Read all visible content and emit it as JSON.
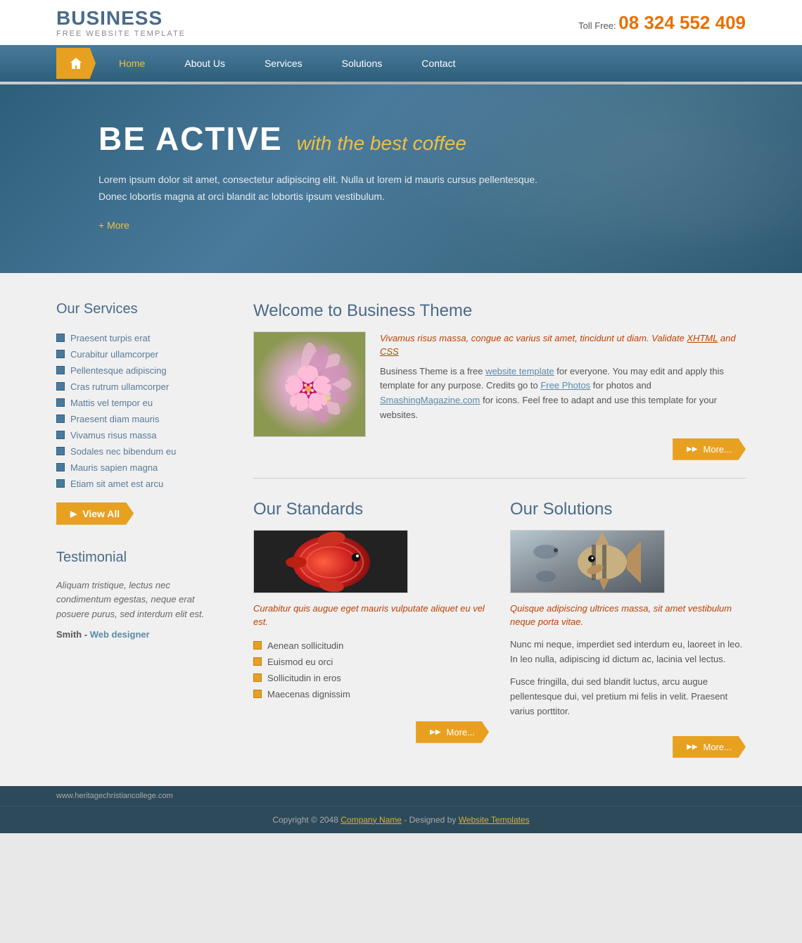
{
  "header": {
    "logo_title": "BUSINESS",
    "logo_sub": "FREE WEBSITE TEMPLATE",
    "toll_free_label": "Toll Free:",
    "phone": "08 324 552 409"
  },
  "nav": {
    "home_label": "Home",
    "items": [
      {
        "label": "About Us"
      },
      {
        "label": "Services"
      },
      {
        "label": "Solutions"
      },
      {
        "label": "Contact"
      }
    ]
  },
  "hero": {
    "title_main": "BE ACTIVE",
    "title_sub": "with the best coffee",
    "description": "Lorem ipsum dolor sit amet, consectetur adipiscing elit. Nulla ut lorem id mauris cursus pellentesque. Donec lobortis magna at orci blandit ac lobortis ipsum vestibulum.",
    "more_label": "+ More"
  },
  "sidebar": {
    "services_title": "Our Services",
    "services": [
      "Praesent turpis erat",
      "Curabitur ullamcorper",
      "Pellentesque adipiscing",
      "Cras rutrum ullamcorper",
      "Mattis vel tempor eu",
      "Praesent diam mauris",
      "Vivamus risus massa",
      "Sodales nec bibendum eu",
      "Mauris sapien magna",
      "Etiam sit amet est arcu"
    ],
    "view_all_label": "View All",
    "testimonial_title": "Testimonial",
    "testimonial_text": "Aliquam tristique, lectus nec condimentum egestas, neque erat posuere purus, sed interdum elit est.",
    "testimonial_author": "Smith",
    "testimonial_role": "Web designer"
  },
  "welcome": {
    "title": "Welcome to Business Theme",
    "highlight": "Vivamus risus massa, congue ac varius sit amet, tincidunt ut diam. Validate XHTML and CSS",
    "body": "Business Theme is a free website template for everyone. You may edit and apply this template for any purpose. Credits go to Free Photos for photos and SmashingMagazine.com for icons. Feel free to adapt and use this template for your websites.",
    "more_label": "More..."
  },
  "standards": {
    "title": "Our Standards",
    "highlight": "Curabitur quis augue eget mauris vulputate aliquet eu vel est.",
    "items": [
      "Aenean sollicitudin",
      "Euismod eu orci",
      "Sollicitudin in eros",
      "Maecenas dignissim"
    ],
    "more_label": "More..."
  },
  "solutions": {
    "title": "Our Solutions",
    "highlight": "Quisque adipiscing ultrices massa, sit amet vestibulum neque porta vitae.",
    "body1": "Nunc mi neque, imperdiet sed interdum eu, laoreet in leo. In leo nulla, adipiscing id dictum ac, lacinia vel lectus.",
    "body2": "Fusce fringilla, dui sed blandit luctus, arcu augue pellentesque dui, vel pretium mi felis in velit. Praesent varius porttitor.",
    "more_label": "More..."
  },
  "footer": {
    "url": "www.heritagechristiancollege.com",
    "copyright": "Copyright © 2048",
    "company_label": "Company Name",
    "designed_by": "Designed by",
    "website_templates_label": "Website Templates"
  }
}
